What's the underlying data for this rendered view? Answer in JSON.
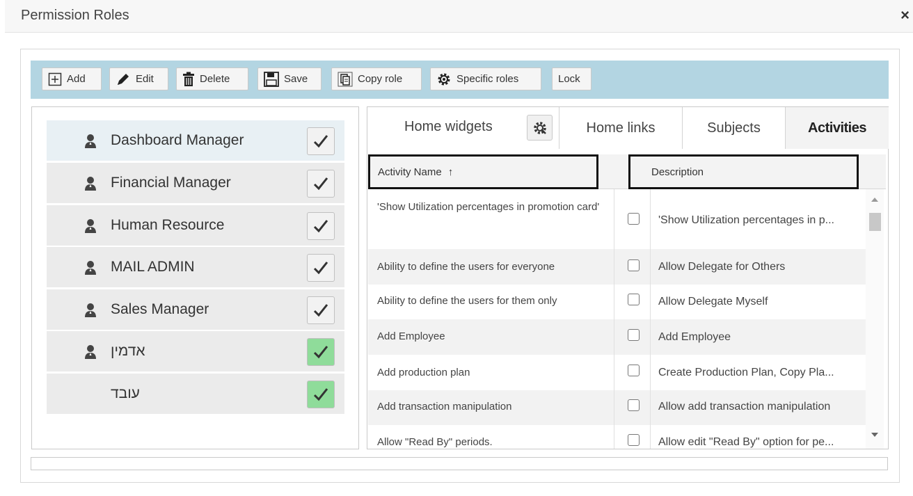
{
  "window": {
    "title": "Permission Roles",
    "close_glyph": "×"
  },
  "toolbar": {
    "add": "Add",
    "edit": "Edit",
    "delete": "Delete",
    "save": "Save",
    "copy_role": "Copy role",
    "specific_roles": "Specific roles",
    "lock": "Lock"
  },
  "roles": [
    {
      "name": "Dashboard Manager",
      "checked": true,
      "style": "gray"
    },
    {
      "name": "Financial Manager",
      "checked": true,
      "style": "gray"
    },
    {
      "name": "Human Resource",
      "checked": true,
      "style": "gray"
    },
    {
      "name": "MAIL ADMIN",
      "checked": true,
      "style": "gray"
    },
    {
      "name": "Sales Manager",
      "checked": true,
      "style": "gray"
    },
    {
      "name": "אדמין",
      "checked": true,
      "style": "green"
    },
    {
      "name": "עובד",
      "checked": true,
      "style": "green"
    }
  ],
  "tabs": [
    {
      "label": "Home widgets"
    },
    {
      "label": "Home links"
    },
    {
      "label": "Subjects"
    },
    {
      "label": "Activities",
      "active": true
    }
  ],
  "grid": {
    "col_name": "Activity Name",
    "sort_glyph": "↑",
    "col_desc": "Description",
    "rows": [
      {
        "name": "'Show Utilization percentages in promotion card'",
        "checked": false,
        "desc": "'Show Utilization percentages in p..."
      },
      {
        "name": "Ability to define the users for everyone",
        "checked": false,
        "desc": "Allow Delegate for Others"
      },
      {
        "name": "Ability to define the users for them only",
        "checked": false,
        "desc": "Allow Delegate Myself"
      },
      {
        "name": "Add Employee",
        "checked": false,
        "desc": "Add Employee"
      },
      {
        "name": "Add production plan",
        "checked": false,
        "desc": "Create Production Plan, Copy Pla..."
      },
      {
        "name": "Add transaction manipulation",
        "checked": false,
        "desc": "Allow add transaction manipulation"
      },
      {
        "name": "Allow \"Read By\" periods.",
        "checked": false,
        "desc": "Allow edit \"Read By\" option for pe..."
      }
    ]
  },
  "colors": {
    "toolbar_bg": "#b3d5e2",
    "check_green": "#8fdc9a",
    "selected_role_bg": "#e8f0f4"
  }
}
